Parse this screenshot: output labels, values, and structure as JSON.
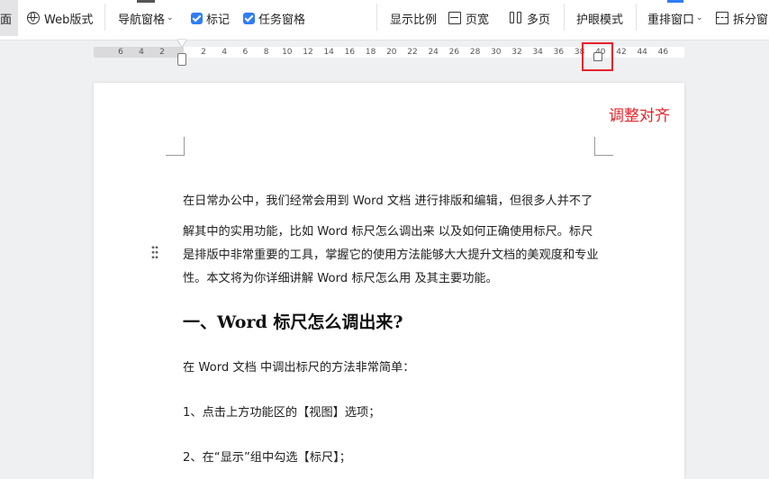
{
  "toolbar": {
    "items": [
      {
        "label": "面",
        "icon": ""
      },
      {
        "label": "Web版式",
        "icon": "globe-icon"
      },
      {
        "label": "导航窗格",
        "icon": "chevron-down-icon"
      },
      {
        "label": "标记",
        "icon": "checkbox-checked-icon"
      },
      {
        "label": "任务窗格",
        "icon": "checkbox-checked-icon"
      },
      {
        "label": "显示比例",
        "icon": ""
      },
      {
        "label": "页宽",
        "icon": "page-width-icon"
      },
      {
        "label": "多页",
        "icon": "multi-page-icon"
      },
      {
        "label": "护眼模式",
        "icon": ""
      },
      {
        "label": "重排窗口",
        "icon": "chevron-down-icon"
      },
      {
        "label": "拆分窗",
        "icon": "split-window-icon"
      }
    ],
    "caret": "⌄"
  },
  "ruler": {
    "labels": [
      "6",
      "4",
      "2",
      "2",
      "4",
      "6",
      "8",
      "10",
      "12",
      "14",
      "16",
      "18",
      "20",
      "22",
      "24",
      "26",
      "28",
      "30",
      "32",
      "34",
      "36",
      "38",
      "40",
      "42",
      "44",
      "46"
    ]
  },
  "annotation": "调整对齐",
  "document": {
    "paragraph_lines": [
      "在日常办公中，我们经常会用到 Word 文档 进行排版和编辑，但很多人并不了",
      "解其中的实用功能，比如 Word 标尺怎么调出来 以及如何正确使用标尺。标尺",
      "是排版中非常重要的工具，掌握它的使用方法能够大大提升文档的美观度和专业",
      "性。本文将为你详细讲解 Word 标尺怎么用 及其主要功能。"
    ],
    "heading": "一、Word 标尺怎么调出来?",
    "intro": "在 Word 文档 中调出标尺的方法非常简单：",
    "step1": "1、点击上方功能区的【视图】选项；",
    "step2": "2、在“显示”组中勾选【标尺】；"
  },
  "colors": {
    "accent": "#2f7cf6",
    "highlight": "#e8222a"
  }
}
